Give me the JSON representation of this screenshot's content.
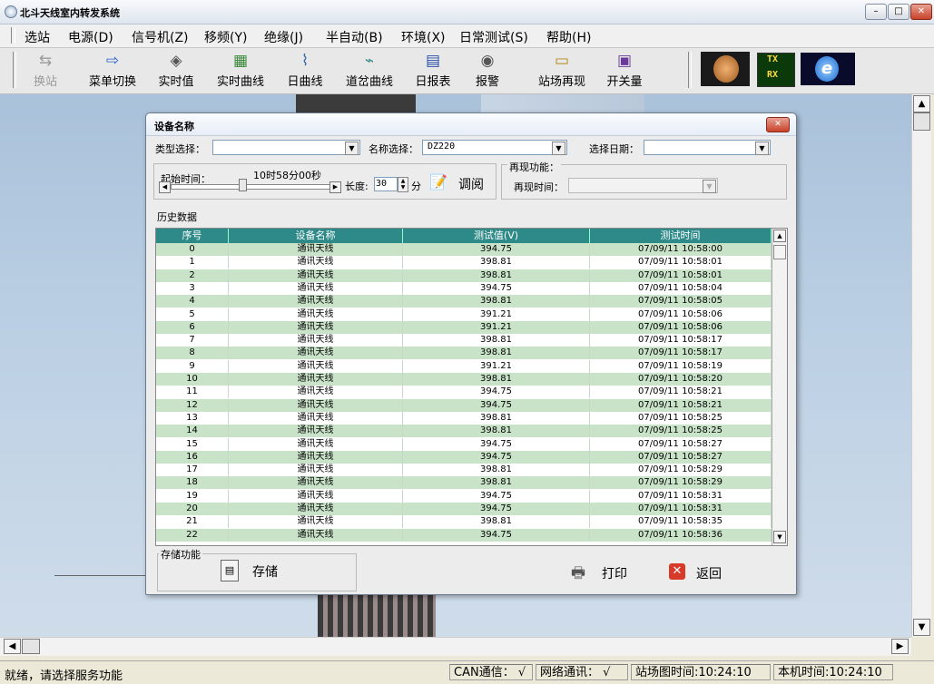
{
  "window": {
    "title": "北斗天线室内转发系统",
    "min": "–",
    "max": "□",
    "close": "✕"
  },
  "menu": [
    "选站",
    "电源(D)",
    "信号机(Z)",
    "移频(Y)",
    "绝缘(J)",
    "半自动(B)",
    "环境(X)",
    "日常测试(S)",
    "帮助(H)"
  ],
  "toolbar": [
    {
      "label": "换站",
      "icon": "⇆",
      "disabled": true
    },
    {
      "label": "菜单切换",
      "icon": "⇨"
    },
    {
      "label": "实时值",
      "icon": "◈"
    },
    {
      "label": "实时曲线",
      "icon": "▦"
    },
    {
      "label": "日曲线",
      "icon": "⌇"
    },
    {
      "label": "道岔曲线",
      "icon": "⌁"
    },
    {
      "label": "日报表",
      "icon": "▤"
    },
    {
      "label": "报警",
      "icon": "◉"
    },
    {
      "label": "站场再现",
      "icon": "▭"
    },
    {
      "label": "开关量",
      "icon": "▣"
    }
  ],
  "toolbar_extra": {
    "tx": "TX",
    "rx": "RX"
  },
  "dialog": {
    "title": "设备名称",
    "type_label": "类型选择：",
    "type_value": "",
    "name_label": "名称选择：",
    "name_value": "DZ220",
    "date_label": "选择日期：",
    "date_value": "",
    "start_label": "起始时间：",
    "start_value": "10时58分00秒",
    "length_label": "长度:",
    "length_value": "30",
    "length_unit": "分",
    "review_button": "调阅",
    "replay_group": "再现功能：",
    "replay_time_label": "再现时间：",
    "history_label": "历史数据",
    "columns": [
      "序号",
      "设备名称",
      "测试值(V)",
      "测试时间"
    ],
    "rows": [
      [
        "0",
        "通讯天线",
        "394.75",
        "07/09/11 10:58:00"
      ],
      [
        "1",
        "通讯天线",
        "398.81",
        "07/09/11 10:58:01"
      ],
      [
        "2",
        "通讯天线",
        "398.81",
        "07/09/11 10:58:01"
      ],
      [
        "3",
        "通讯天线",
        "394.75",
        "07/09/11 10:58:04"
      ],
      [
        "4",
        "通讯天线",
        "398.81",
        "07/09/11 10:58:05"
      ],
      [
        "5",
        "通讯天线",
        "391.21",
        "07/09/11 10:58:06"
      ],
      [
        "6",
        "通讯天线",
        "391.21",
        "07/09/11 10:58:06"
      ],
      [
        "7",
        "通讯天线",
        "398.81",
        "07/09/11 10:58:17"
      ],
      [
        "8",
        "通讯天线",
        "398.81",
        "07/09/11 10:58:17"
      ],
      [
        "9",
        "通讯天线",
        "391.21",
        "07/09/11 10:58:19"
      ],
      [
        "10",
        "通讯天线",
        "398.81",
        "07/09/11 10:58:20"
      ],
      [
        "11",
        "通讯天线",
        "394.75",
        "07/09/11 10:58:21"
      ],
      [
        "12",
        "通讯天线",
        "394.75",
        "07/09/11 10:58:21"
      ],
      [
        "13",
        "通讯天线",
        "398.81",
        "07/09/11 10:58:25"
      ],
      [
        "14",
        "通讯天线",
        "398.81",
        "07/09/11 10:58:25"
      ],
      [
        "15",
        "通讯天线",
        "394.75",
        "07/09/11 10:58:27"
      ],
      [
        "16",
        "通讯天线",
        "394.75",
        "07/09/11 10:58:27"
      ],
      [
        "17",
        "通讯天线",
        "398.81",
        "07/09/11 10:58:29"
      ],
      [
        "18",
        "通讯天线",
        "398.81",
        "07/09/11 10:58:29"
      ],
      [
        "19",
        "通讯天线",
        "394.75",
        "07/09/11 10:58:31"
      ],
      [
        "20",
        "通讯天线",
        "394.75",
        "07/09/11 10:58:31"
      ],
      [
        "21",
        "通讯天线",
        "398.81",
        "07/09/11 10:58:35"
      ],
      [
        "22",
        "通讯天线",
        "394.75",
        "07/09/11 10:58:36"
      ]
    ],
    "storage_group": "存储功能",
    "save_button": "存储",
    "print_button": "打印",
    "back_button": "返回"
  },
  "status": {
    "message": "就绪，请选择服务功能",
    "can": "CAN通信：",
    "can_ok": "√",
    "net": "网络通讯：",
    "net_ok": "√",
    "station_time": "站场图时间:10:24:10",
    "local_time": "本机时间:10:24:10"
  },
  "colors": {
    "header": "#2e8a88",
    "row_alt": "#c9e3c9",
    "close": "#c8422a"
  }
}
